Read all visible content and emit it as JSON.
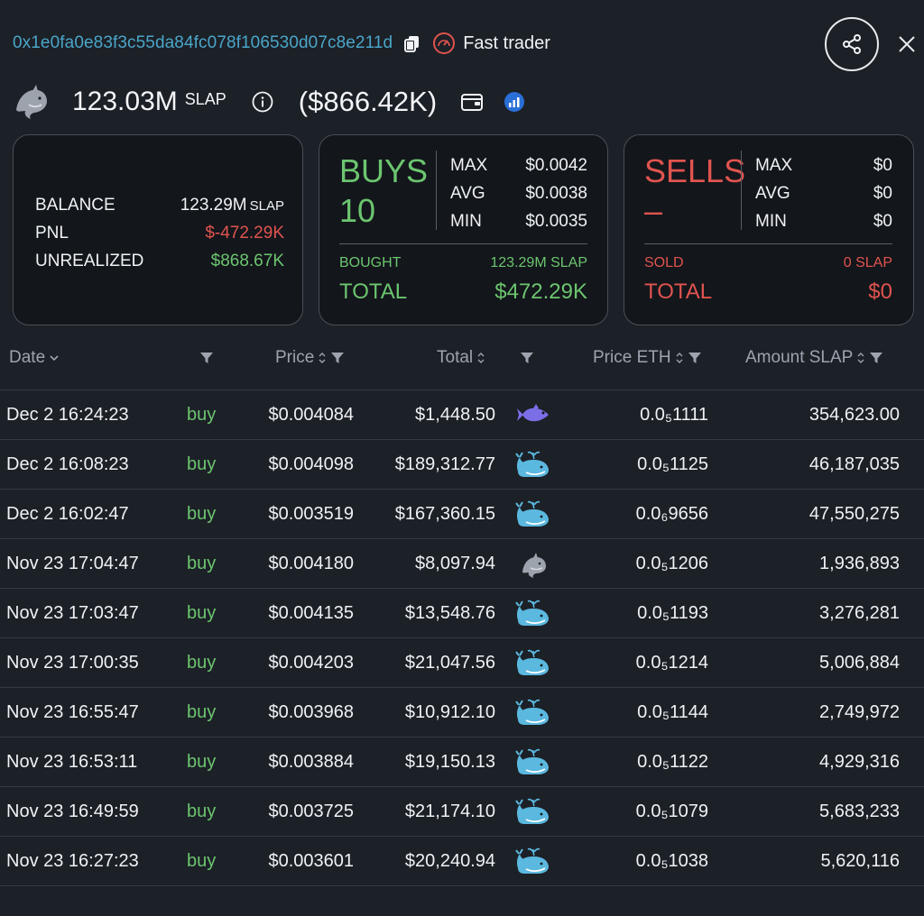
{
  "header": {
    "address": "0x1e0fa0e83f3c55da84fc078f106530d07c8e211d",
    "badge": "Fast trader"
  },
  "balance": {
    "amount": "123.03M",
    "unit": "SLAP",
    "usd": "($866.42K)"
  },
  "summary": {
    "balance_label": "BALANCE",
    "balance_value": "123.29M",
    "balance_unit": "SLAP",
    "pnl_label": "PNL",
    "pnl_value": "$-472.29K",
    "unrealized_label": "UNREALIZED",
    "unrealized_value": "$868.67K"
  },
  "buys": {
    "title": "BUYS",
    "count": "10",
    "max_label": "MAX",
    "max": "$0.0042",
    "avg_label": "AVG",
    "avg": "$0.0038",
    "min_label": "MIN",
    "min": "$0.0035",
    "bought_label": "BOUGHT",
    "bought": "123.29M SLAP",
    "total_label": "TOTAL",
    "total": "$472.29K"
  },
  "sells": {
    "title": "SELLS",
    "count": "–",
    "max_label": "MAX",
    "max": "$0",
    "avg_label": "AVG",
    "avg": "$0",
    "min_label": "MIN",
    "min": "$0",
    "sold_label": "SOLD",
    "sold": "0 SLAP",
    "total_label": "TOTAL",
    "total": "$0"
  },
  "table": {
    "headers": {
      "date": "Date",
      "price": "Price",
      "total": "Total",
      "price_eth": "Price ETH",
      "amount": "Amount SLAP"
    },
    "rows": [
      {
        "date": "Dec 2 16:24:23",
        "type": "buy",
        "price": "$0.004084",
        "total": "$1,448.50",
        "icon": "fish-icon",
        "eth": "0.0₅1111",
        "amount": "354,623.00"
      },
      {
        "date": "Dec 2 16:08:23",
        "type": "buy",
        "price": "$0.004098",
        "total": "$189,312.77",
        "icon": "whale-icon",
        "eth": "0.0₅1125",
        "amount": "46,187,035"
      },
      {
        "date": "Dec 2 16:02:47",
        "type": "buy",
        "price": "$0.003519",
        "total": "$167,360.15",
        "icon": "whale-icon",
        "eth": "0.0₆9656",
        "amount": "47,550,275"
      },
      {
        "date": "Nov 23 17:04:47",
        "type": "buy",
        "price": "$0.004180",
        "total": "$8,097.94",
        "icon": "dolphin-icon",
        "eth": "0.0₅1206",
        "amount": "1,936,893"
      },
      {
        "date": "Nov 23 17:03:47",
        "type": "buy",
        "price": "$0.004135",
        "total": "$13,548.76",
        "icon": "whale-icon",
        "eth": "0.0₅1193",
        "amount": "3,276,281"
      },
      {
        "date": "Nov 23 17:00:35",
        "type": "buy",
        "price": "$0.004203",
        "total": "$21,047.56",
        "icon": "whale-icon",
        "eth": "0.0₅1214",
        "amount": "5,006,884"
      },
      {
        "date": "Nov 23 16:55:47",
        "type": "buy",
        "price": "$0.003968",
        "total": "$10,912.10",
        "icon": "whale-icon",
        "eth": "0.0₅1144",
        "amount": "2,749,972"
      },
      {
        "date": "Nov 23 16:53:11",
        "type": "buy",
        "price": "$0.003884",
        "total": "$19,150.13",
        "icon": "whale-icon",
        "eth": "0.0₅1122",
        "amount": "4,929,316"
      },
      {
        "date": "Nov 23 16:49:59",
        "type": "buy",
        "price": "$0.003725",
        "total": "$21,174.10",
        "icon": "whale-icon",
        "eth": "0.0₅1079",
        "amount": "5,683,233"
      },
      {
        "date": "Nov 23 16:27:23",
        "type": "buy",
        "price": "$0.003601",
        "total": "$20,240.94",
        "icon": "whale-icon",
        "eth": "0.0₅1038",
        "amount": "5,620,116"
      }
    ]
  },
  "colors": {
    "background": "#1c2027",
    "card": "#13161b",
    "positive": "#6cc56f",
    "negative": "#e0544f",
    "link": "#4aa6c9",
    "whale": "#5bb8df",
    "fish": "#7b6fe8"
  }
}
